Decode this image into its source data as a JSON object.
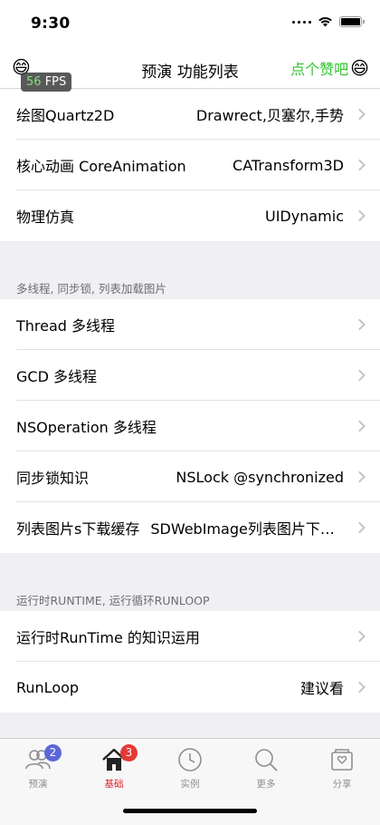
{
  "status": {
    "time": "9:30"
  },
  "nav": {
    "left_emoji": "😄",
    "title": "预演 功能列表",
    "right_label": "点个赞吧",
    "right_emoji": "😄"
  },
  "fps": {
    "value": "56",
    "unit": "FPS"
  },
  "sections": [
    {
      "header": "",
      "rows": [
        {
          "title": "绘图Quartz2D",
          "detail": "Drawrect,贝塞尔,手势"
        },
        {
          "title": "核心动画 CoreAnimation",
          "detail": "CATransform3D"
        },
        {
          "title": "物理仿真",
          "detail": "UIDynamic"
        }
      ]
    },
    {
      "header": "多线程, 同步锁, 列表加载图片",
      "rows": [
        {
          "title": "Thread 多线程",
          "detail": ""
        },
        {
          "title": "GCD 多线程",
          "detail": ""
        },
        {
          "title": "NSOperation 多线程",
          "detail": ""
        },
        {
          "title": "同步锁知识",
          "detail": "NSLock @synchronized"
        },
        {
          "title": "列表图片s下载缓存",
          "detail": "SDWebImage列表图片下载缓存"
        }
      ]
    },
    {
      "header": "运行时RUNTIME, 运行循环RUNLOOP",
      "rows": [
        {
          "title": "运行时RunTime 的知识运用",
          "detail": ""
        },
        {
          "title": "RunLoop",
          "detail": "建议看"
        }
      ]
    }
  ],
  "tabs": [
    {
      "label": "预演",
      "icon": "people-icon",
      "badge": "2",
      "badge_color": "#5b67d8",
      "active": false
    },
    {
      "label": "基础",
      "icon": "home-icon",
      "badge": "3",
      "badge_color": "#e53935",
      "active": true
    },
    {
      "label": "实例",
      "icon": "clock-icon",
      "badge": "",
      "active": false
    },
    {
      "label": "更多",
      "icon": "search-icon",
      "badge": "",
      "active": false
    },
    {
      "label": "分享",
      "icon": "share-box-icon",
      "badge": "",
      "active": false
    }
  ],
  "colors": {
    "accent_green": "#2ec52e",
    "tab_active": "#e0252b",
    "tab_inactive": "#8e8e93"
  }
}
